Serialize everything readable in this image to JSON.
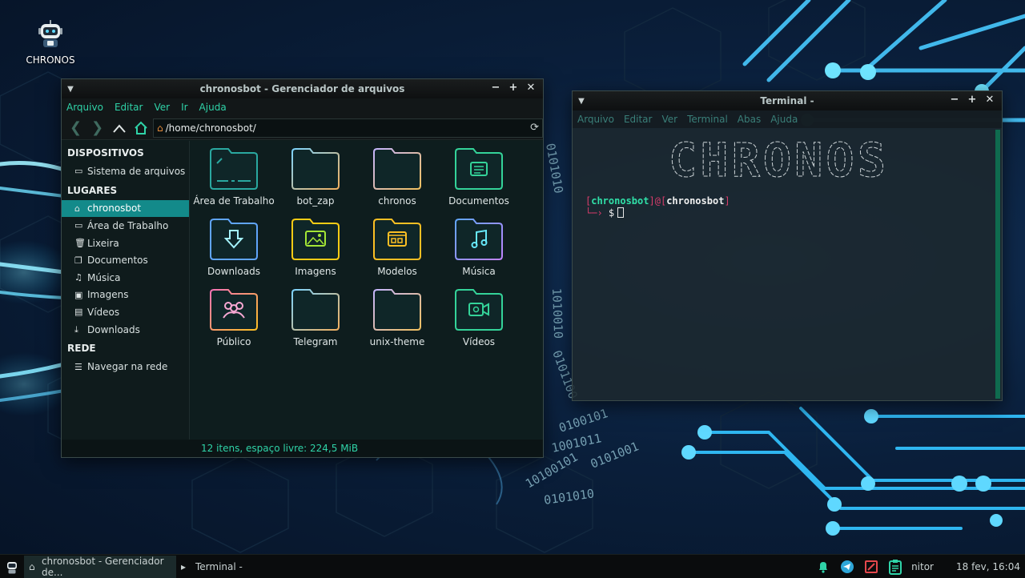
{
  "desktop": {
    "icon_label": "CHRONOS"
  },
  "file_manager": {
    "title": "chronosbot - Gerenciador de arquivos",
    "menu": [
      "Arquivo",
      "Editar",
      "Ver",
      "Ir",
      "Ajuda"
    ],
    "path": "/home/chronosbot/",
    "sidebar": {
      "devices_header": "DISPOSITIVOS",
      "devices": [
        "Sistema de arquivos"
      ],
      "places_header": "LUGARES",
      "places": [
        "chronosbot",
        "Área de Trabalho",
        "Lixeira",
        "Documentos",
        "Música",
        "Imagens",
        "Vídeos",
        "Downloads"
      ],
      "network_header": "REDE",
      "network": [
        "Navegar na rede"
      ]
    },
    "items": [
      "Área de Trabalho",
      "bot_zap",
      "chronos",
      "Documentos",
      "Downloads",
      "Imagens",
      "Modelos",
      "Música",
      "Público",
      "Telegram",
      "unix-theme",
      "Vídeos"
    ],
    "status": "12 itens, espaço livre: 224,5 MiB"
  },
  "terminal": {
    "title": "Terminal -",
    "menu": [
      "Arquivo",
      "Editar",
      "Ver",
      "Terminal",
      "Abas",
      "Ajuda"
    ],
    "banner": "CHRONOS",
    "prompt_user": "chronosbot",
    "prompt_at": "@",
    "prompt_host": "chronosbot",
    "prompt_symbol": "$"
  },
  "taskbar": {
    "tasks": [
      "chronosbot - Gerenciador de...",
      "Terminal -"
    ],
    "tray_text": "nitor",
    "clock": "18 fev, 16:04"
  },
  "colors": {
    "accent": "#2fd3a8",
    "selection": "#138a8a",
    "prompt_bracket": "#d83c6b"
  }
}
